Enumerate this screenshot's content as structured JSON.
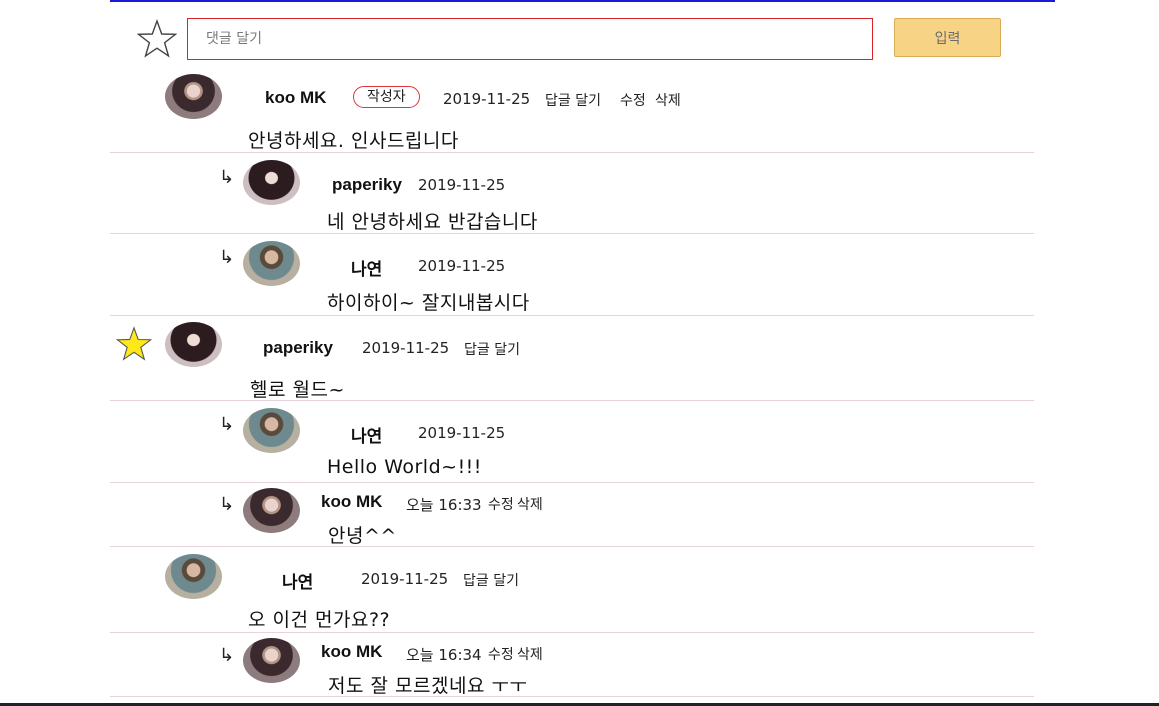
{
  "compose": {
    "placeholder": "댓글 달기",
    "submit_label": "입력"
  },
  "comments": [
    {
      "author": "koo MK",
      "badge": "작성자",
      "date": "2019-11-25",
      "reply_action": "답글 달기",
      "edit_action": "수정",
      "delete_action": "삭제",
      "body": "안녕하세요. 인사드립니다",
      "favorited": false,
      "replies": [
        {
          "author": "paperiky",
          "date": "2019-11-25",
          "body": "네 안녕하세요 반갑습니다"
        },
        {
          "author": "나연",
          "date": "2019-11-25",
          "body": "하이하이~ 잘지내봅시다"
        }
      ]
    },
    {
      "author": "paperiky",
      "date": "2019-11-25",
      "reply_action": "답글 달기",
      "body": "헬로 월드~",
      "favorited": true,
      "replies": [
        {
          "author": "나연",
          "date": "2019-11-25",
          "body": "Hello World~!!!"
        },
        {
          "author": "koo MK",
          "date": "오늘 16:33",
          "edit_action": "수정",
          "delete_action": "삭제",
          "body": "안녕^^"
        }
      ]
    },
    {
      "author": "나연",
      "date": "2019-11-25",
      "reply_action": "답글 달기",
      "body": "오 이건 먼가요??",
      "replies": [
        {
          "author": "koo MK",
          "date": "오늘 16:34",
          "edit_action": "수정",
          "delete_action": "삭제",
          "body": "저도 잘 모르겠네요 ㅜㅜ"
        }
      ]
    }
  ],
  "reply_marker": "↳",
  "colors": {
    "top_border": "#1b1bd6",
    "input_border": "#d9242c",
    "submit_bg": "#f7d385",
    "badge_border": "#e0343c",
    "star_filled": "#ffe81a",
    "divider": "#e7d3d9"
  },
  "icons": {
    "compose_star": "star-outline-icon",
    "favorite_star": "star-filled-icon"
  }
}
